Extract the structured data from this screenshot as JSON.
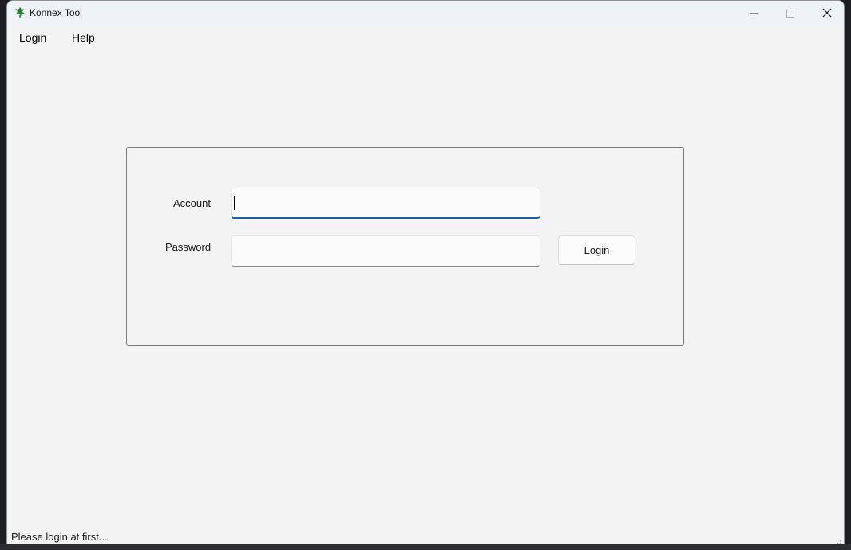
{
  "window": {
    "title": "Konnex Tool"
  },
  "menu": {
    "items": [
      {
        "label": "Login"
      },
      {
        "label": "Help"
      }
    ]
  },
  "form": {
    "account_label": "Account",
    "account_value": "",
    "password_label": "Password",
    "password_value": "",
    "login_button": "Login"
  },
  "status": {
    "text": "Please login at first..."
  },
  "colors": {
    "focus_underline": "#1f5fa8",
    "window_bg": "#f3f3f3",
    "titlebar_bg": "#eef3f6",
    "app_icon": "#2e7d32"
  },
  "icons": {
    "app": "leaf-app-icon",
    "minimize": "minimize-icon",
    "maximize": "maximize-icon",
    "close": "close-icon",
    "resize": "resize-grip-icon"
  }
}
